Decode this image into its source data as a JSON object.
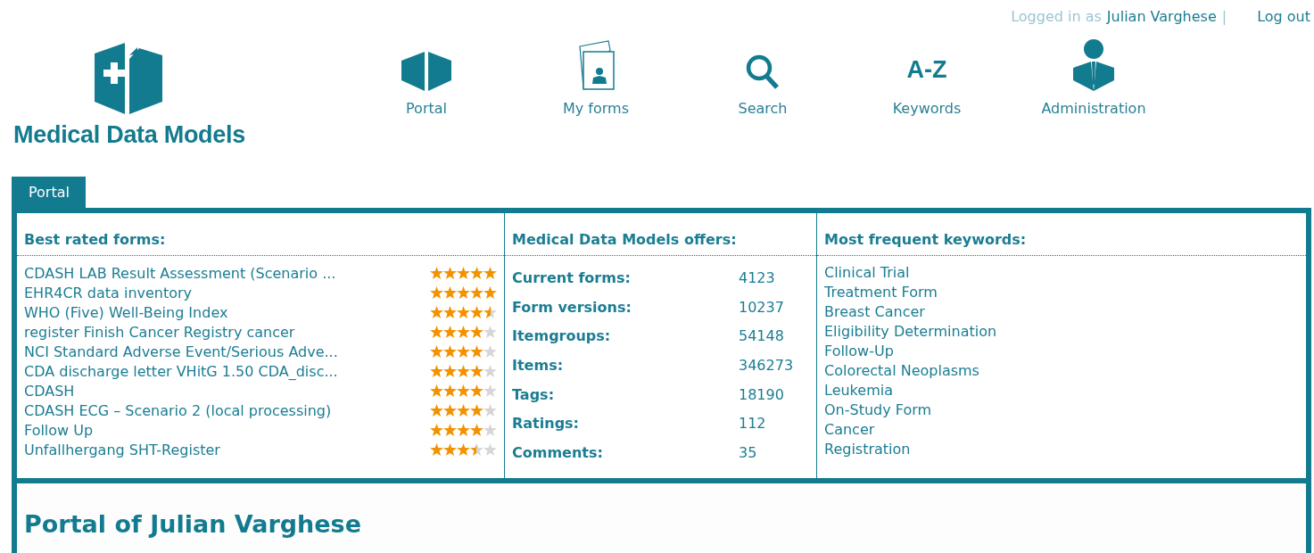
{
  "user_bar": {
    "prefix": "Logged in as",
    "user": "Julian Varghese",
    "separator": "|",
    "logout": "Log out"
  },
  "logo": {
    "title": "Medical Data Models"
  },
  "nav": [
    {
      "label": "Portal",
      "kind": "portal"
    },
    {
      "label": "My forms",
      "kind": "forms"
    },
    {
      "label": "Search",
      "kind": "search"
    },
    {
      "label": "Keywords",
      "kind": "keywords",
      "glyph": "A-Z"
    },
    {
      "label": "Administration",
      "kind": "admin"
    }
  ],
  "tabs": [
    {
      "label": "Portal",
      "selected": true
    }
  ],
  "best_rated": {
    "title": "Best rated forms:",
    "items": [
      {
        "name": "CDASH LAB Result Assessment (Scenario ...",
        "stars": 5
      },
      {
        "name": "EHR4CR data inventory",
        "stars": 5
      },
      {
        "name": "WHO (Five) Well-Being Index",
        "stars": 4.5
      },
      {
        "name": "register Finish Cancer Registry cancer",
        "stars": 4
      },
      {
        "name": "NCI Standard Adverse Event/Serious Adve...",
        "stars": 4
      },
      {
        "name": "CDA discharge letter VHitG 1.50 CDA_disc...",
        "stars": 4
      },
      {
        "name": "CDASH",
        "stars": 4
      },
      {
        "name": "CDASH ECG – Scenario 2 (local processing)",
        "stars": 4
      },
      {
        "name": "Follow Up",
        "stars": 4
      },
      {
        "name": "Unfallhergang SHT-Register",
        "stars": 3.5
      }
    ]
  },
  "offers": {
    "title": "Medical Data Models offers:",
    "items": [
      {
        "label": "Current forms:",
        "value": "4123"
      },
      {
        "label": "Form versions:",
        "value": "10237"
      },
      {
        "label": "Itemgroups:",
        "value": "54148"
      },
      {
        "label": "Items:",
        "value": "346273"
      },
      {
        "label": "Tags:",
        "value": "18190"
      },
      {
        "label": "Ratings:",
        "value": "112"
      },
      {
        "label": "Comments:",
        "value": "35"
      }
    ]
  },
  "keywords": {
    "title": "Most frequent keywords:",
    "items": [
      "Clinical Trial",
      "Treatment Form",
      "Breast Cancer",
      "Eligibility Determination",
      "Follow-Up",
      "Colorectal Neoplasms",
      "Leukemia",
      "On-Study Form",
      "Cancer",
      "Registration"
    ]
  },
  "portal": {
    "heading": "Portal of Julian Varghese"
  }
}
